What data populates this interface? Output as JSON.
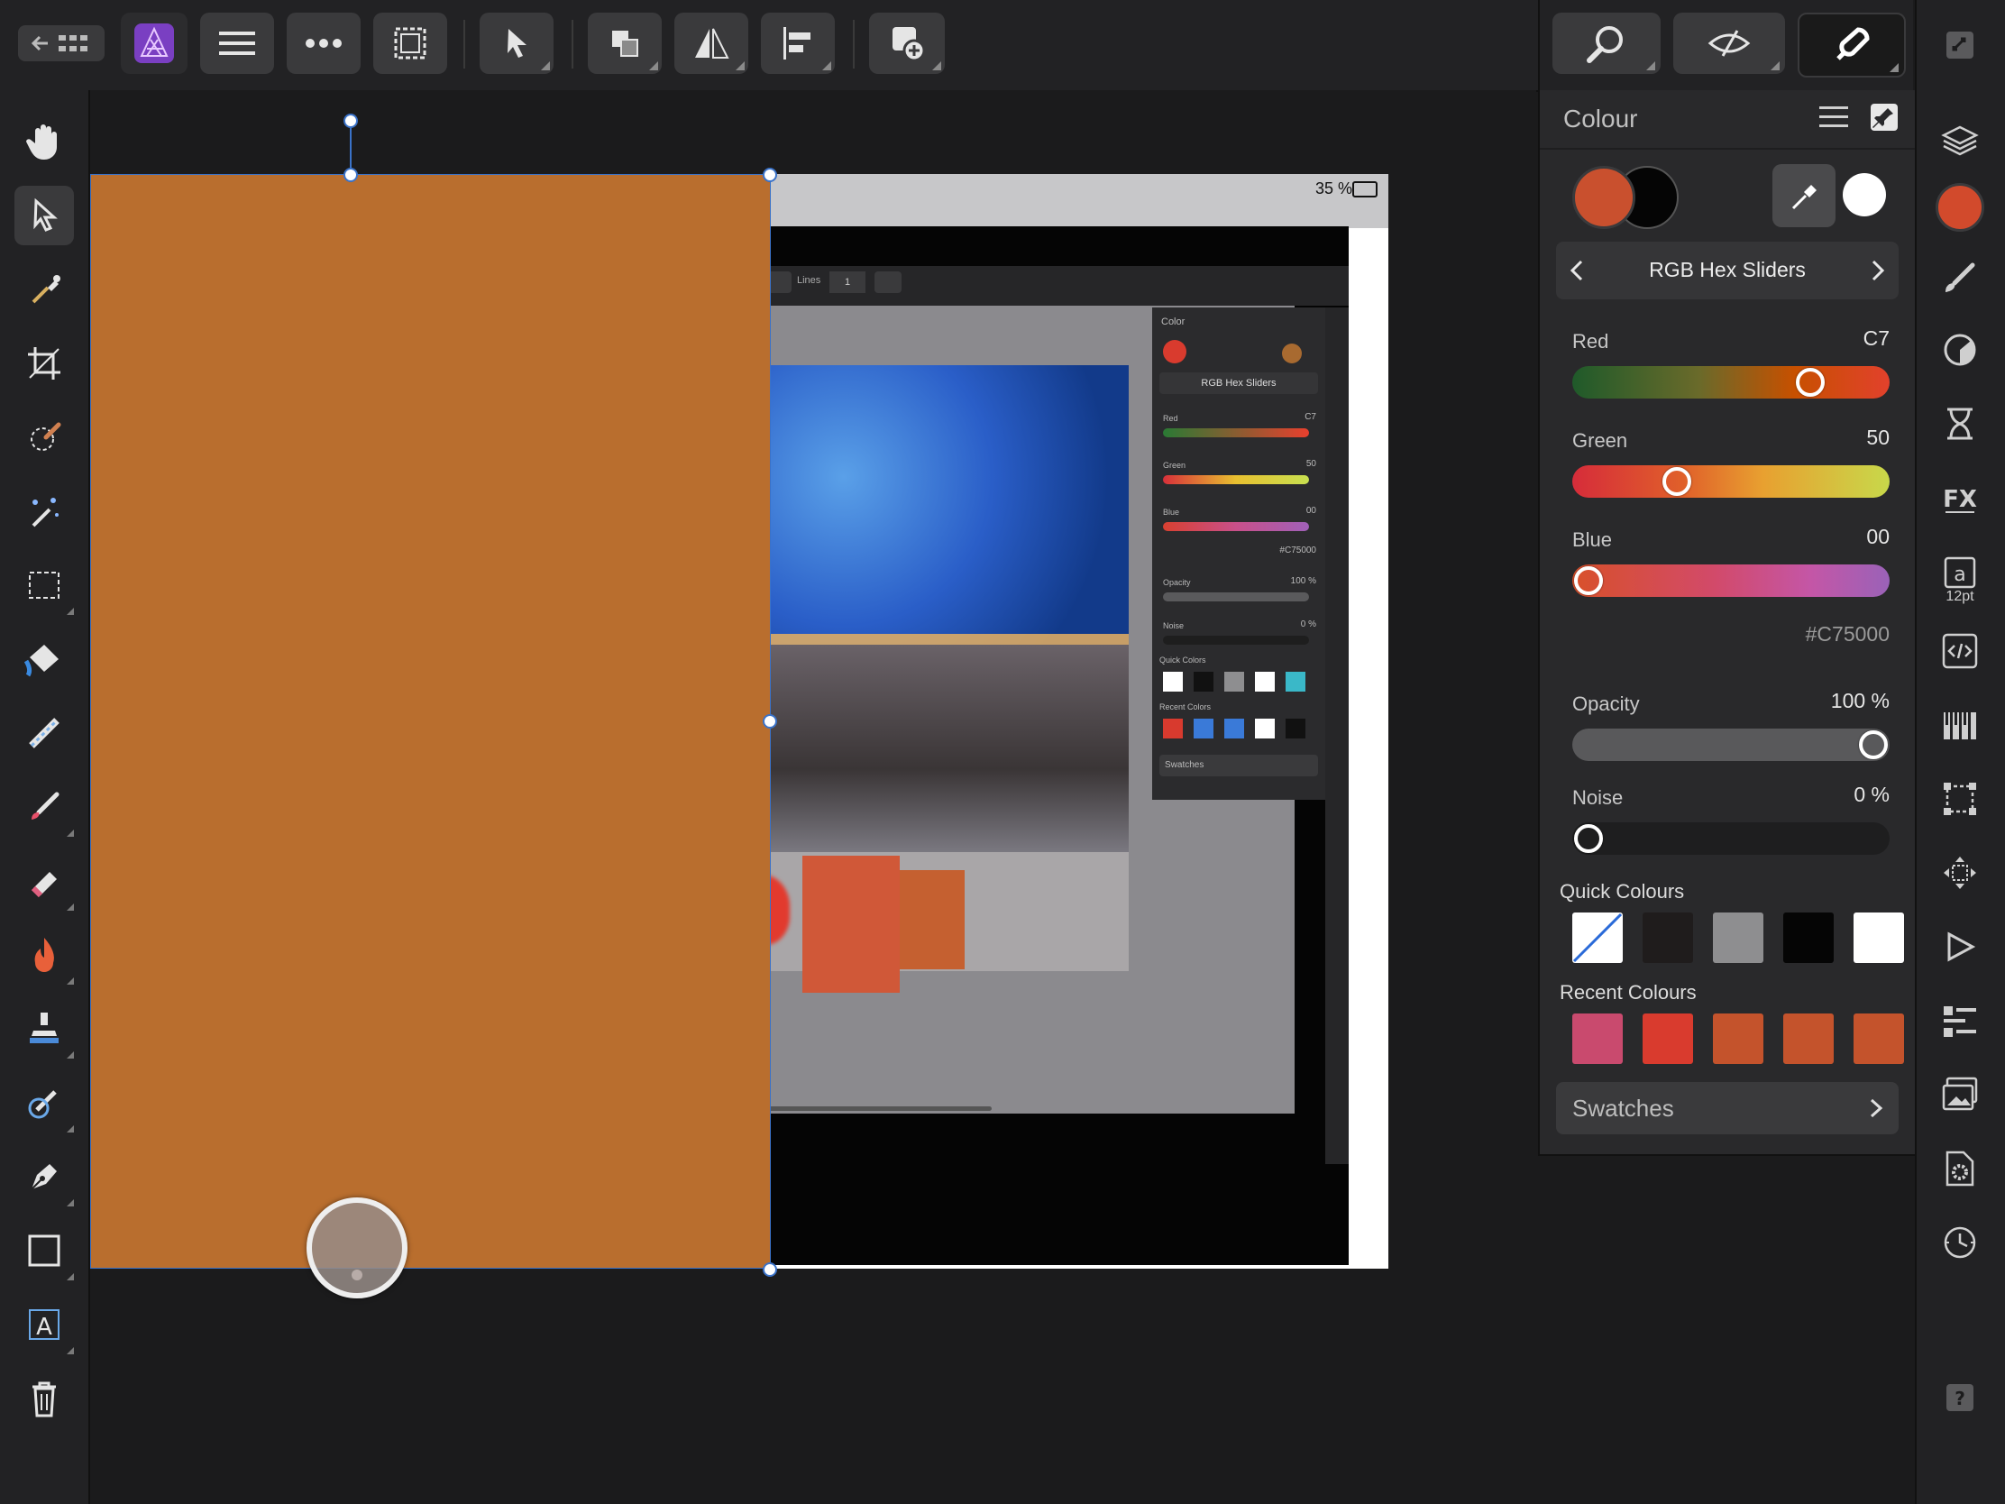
{
  "colour_panel": {
    "title": "Colour",
    "mode_label": "RGB Hex Sliders",
    "sliders": [
      {
        "label": "Red",
        "value": "C7",
        "fraction": 0.78
      },
      {
        "label": "Green",
        "value": "50",
        "fraction": 0.31
      },
      {
        "label": "Blue",
        "value": "00",
        "fraction": 0.0
      }
    ],
    "hex": "#C75000",
    "opacity": {
      "label": "Opacity",
      "value": "100 %",
      "fraction": 1.0
    },
    "noise": {
      "label": "Noise",
      "value": "0 %",
      "fraction": 0.0
    },
    "quick_colours_label": "Quick Colours",
    "quick_colours": [
      "none",
      "#1f1c1c",
      "#8e8e90",
      "#050505",
      "#ffffff"
    ],
    "recent_colours_label": "Recent Colours",
    "recent_colours": [
      "#c94a6e",
      "#d93b2e",
      "#c4532c",
      "#c4532c",
      "#c4532c"
    ],
    "swatches_label": "Swatches",
    "primary_colour": "#c9502e",
    "secondary_colour": "#050505",
    "picker_colour": "#ffffff"
  },
  "right_toolbar": {
    "text_tool_size": "12pt"
  },
  "canvas": {
    "fill_colour": "#b96e2e",
    "embedded_screenshot": {
      "battery": "35 %",
      "lines_label": "Lines",
      "lines_value": "1",
      "panel_title": "Color",
      "mode_label": "RGB Hex Sliders",
      "red_label": "Red",
      "red_value": "C7",
      "green_label": "Green",
      "green_value": "50",
      "blue_label": "Blue",
      "blue_value": "00",
      "hex": "#C75000",
      "opacity_label": "Opacity",
      "opacity_value": "100 %",
      "noise_label": "Noise",
      "noise_value": "0 %",
      "quick_label": "Quick Colors",
      "recent_label": "Recent Colors",
      "swatches_label": "Swatches"
    }
  }
}
